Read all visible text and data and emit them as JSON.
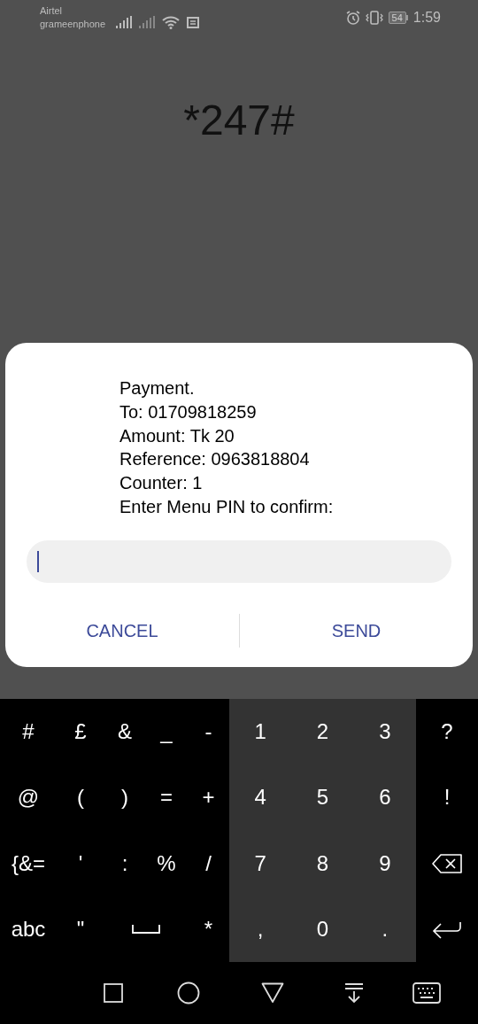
{
  "status_bar": {
    "carriers": [
      "Airtel",
      "grameenphone"
    ],
    "battery": "54",
    "time": "1:59"
  },
  "dialer": {
    "number": "*247#"
  },
  "dialog": {
    "message_lines": [
      "Payment.",
      "To: 01709818259",
      "Amount: Tk 20",
      "Reference: 0963818804",
      "Counter: 1",
      "Enter Menu PIN to confirm:"
    ],
    "input": {
      "focused": true
    },
    "buttons": [
      "CANCEL",
      "SEND"
    ]
  },
  "keyboard": {
    "rows": [
      [
        {
          "kind": "char",
          "label": "#"
        },
        {
          "kind": "char",
          "label": "£"
        },
        {
          "kind": "char",
          "label": "&"
        },
        {
          "kind": "char",
          "label": "_"
        },
        {
          "kind": "char",
          "label": "-"
        },
        {
          "kind": "num",
          "label": "1"
        },
        {
          "kind": "num",
          "label": "2"
        },
        {
          "kind": "num",
          "label": "3"
        },
        {
          "kind": "char",
          "label": "?"
        }
      ],
      [
        {
          "kind": "char",
          "label": "@"
        },
        {
          "kind": "char",
          "label": "("
        },
        {
          "kind": "char",
          "label": ")"
        },
        {
          "kind": "char",
          "label": "="
        },
        {
          "kind": "char",
          "label": "+"
        },
        {
          "kind": "num",
          "label": "4"
        },
        {
          "kind": "num",
          "label": "5"
        },
        {
          "kind": "num",
          "label": "6"
        },
        {
          "kind": "char",
          "label": "!"
        }
      ],
      [
        {
          "kind": "char",
          "label": "{&="
        },
        {
          "kind": "char",
          "label": "'"
        },
        {
          "kind": "char",
          "label": ":"
        },
        {
          "kind": "char",
          "label": "%"
        },
        {
          "kind": "char",
          "label": "/"
        },
        {
          "kind": "num",
          "label": "7"
        },
        {
          "kind": "num",
          "label": "8"
        },
        {
          "kind": "num",
          "label": "9"
        },
        {
          "kind": "backspace"
        }
      ],
      [
        {
          "kind": "char",
          "label": "abc"
        },
        {
          "kind": "char",
          "label": "\""
        },
        {
          "kind": "space"
        },
        {
          "kind": "spacer"
        },
        {
          "kind": "char",
          "label": "*"
        },
        {
          "kind": "num",
          "label": ","
        },
        {
          "kind": "num",
          "label": "0"
        },
        {
          "kind": "num",
          "label": "."
        },
        {
          "kind": "enter"
        }
      ]
    ]
  }
}
